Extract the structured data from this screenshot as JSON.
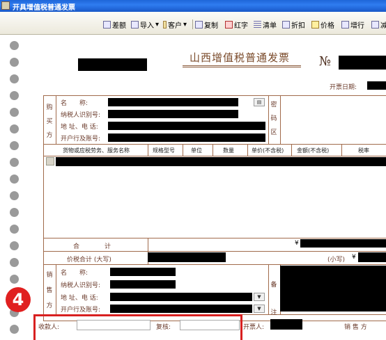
{
  "window": {
    "title": "开具增值税普通发票"
  },
  "toolbar": {
    "items": [
      {
        "label": "差额",
        "icon": "difference-icon"
      },
      {
        "label": "导入",
        "icon": "import-icon"
      },
      {
        "label": "客户",
        "icon": "customer-icon"
      },
      {
        "label": "复制",
        "icon": "copy-icon"
      },
      {
        "label": "红字",
        "icon": "red-letter-icon"
      },
      {
        "label": "清单",
        "icon": "list-icon"
      },
      {
        "label": "折扣",
        "icon": "discount-icon"
      },
      {
        "label": "价格",
        "icon": "price-icon"
      },
      {
        "label": "增行",
        "icon": "add-row-icon"
      },
      {
        "label": "减",
        "icon": "remove-row-icon"
      }
    ],
    "dropdown_arrow": "▾"
  },
  "invoice": {
    "title": "山西增值税普通发票",
    "no_label": "№",
    "date_label": "开票日期:",
    "buyer": {
      "side_label": [
        "购",
        "买",
        "方"
      ],
      "name_label": "名　　称:",
      "taxid_label": "纳税人识别号:",
      "address_label": "地 址、电 话:",
      "bank_label": "开户行及账号:"
    },
    "cipher_label": [
      "密",
      "码",
      "区"
    ],
    "table": {
      "headers": [
        "货物或应税劳务、服务名称",
        "规格型号",
        "单位",
        "数量",
        "单价(不含税)",
        "金额(不含税)",
        "税率"
      ]
    },
    "total_label": "合　　　　计",
    "currency": "¥",
    "grand_total_label": "价税合计 (大写)",
    "small_label": "(小写)",
    "seller": {
      "side_label": [
        "销",
        "售",
        "方"
      ],
      "name_label": "名　　称:",
      "taxid_label": "纳税人识别号:",
      "address_label": "地 址、电 话:",
      "bank_label": "开户行及账号:"
    },
    "remark_label": [
      "备",
      "注"
    ],
    "footer": {
      "payee_label": "收款人:",
      "reviewer_label": "复核:",
      "issuer_label": "开票人:",
      "seller_label": "销 售 方"
    }
  },
  "annotation": {
    "step": "4",
    "color": "#d82020"
  }
}
